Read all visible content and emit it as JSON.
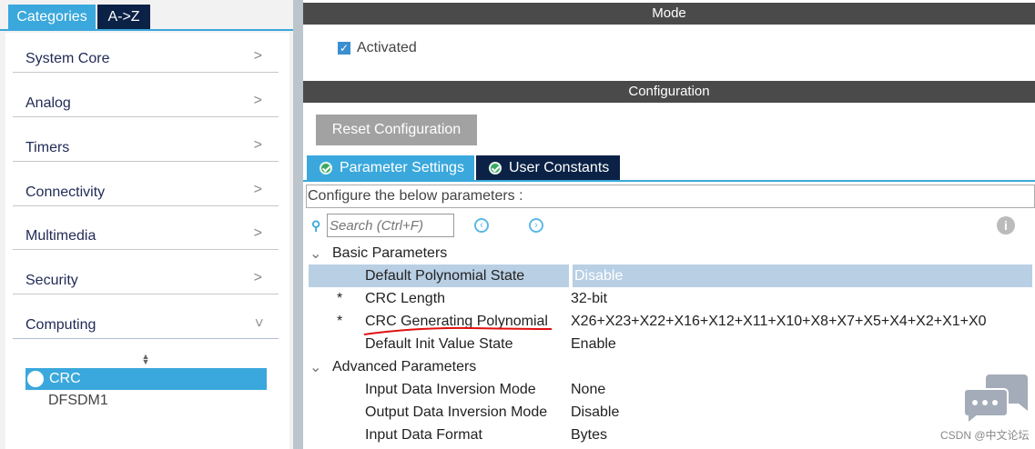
{
  "left": {
    "tabs": [
      "Categories",
      "A->Z"
    ],
    "categories": [
      {
        "label": "System Core"
      },
      {
        "label": "Analog"
      },
      {
        "label": "Timers"
      },
      {
        "label": "Connectivity"
      },
      {
        "label": "Multimedia"
      },
      {
        "label": "Security"
      },
      {
        "label": "Computing"
      }
    ],
    "computing_items": [
      "CRC",
      "DFSDM1"
    ]
  },
  "mode": {
    "title": "Mode",
    "activated_label": "Activated",
    "activated": true
  },
  "config": {
    "title": "Configuration",
    "reset_label": "Reset Configuration",
    "tabs": [
      "Parameter Settings",
      "User Constants"
    ],
    "configure_text": "Configure the below parameters :",
    "search_placeholder": "Search (Ctrl+F)",
    "groups": [
      {
        "label": "Basic Parameters",
        "rows": [
          {
            "star": "",
            "name": "Default Polynomial State",
            "value": "Disable"
          },
          {
            "star": "*",
            "name": "CRC Length",
            "value": "32-bit"
          },
          {
            "star": "*",
            "name": "CRC Generating Polynomial",
            "value": "X26+X23+X22+X16+X12+X11+X10+X8+X7+X5+X4+X2+X1+X0"
          },
          {
            "star": "",
            "name": "Default Init Value State",
            "value": "Enable"
          }
        ]
      },
      {
        "label": "Advanced Parameters",
        "rows": [
          {
            "star": "",
            "name": "Input Data Inversion Mode",
            "value": "None"
          },
          {
            "star": "",
            "name": "Output Data Inversion Mode",
            "value": "Disable"
          },
          {
            "star": "",
            "name": "Input Data Format",
            "value": "Bytes"
          }
        ]
      }
    ]
  },
  "watermark": "CSDN @中文论坛",
  "colors": {
    "accent": "#3aa8dc",
    "dark": "#0b2246",
    "bar": "#4a4a4a",
    "selected_row": "#b9cfe4"
  }
}
